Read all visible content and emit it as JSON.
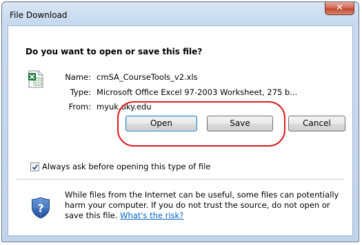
{
  "window": {
    "title": "File Download",
    "close_glyph": "✕"
  },
  "dialog": {
    "question": "Do you want to open or save this file?",
    "file_icon": "excel-file-icon",
    "fields": [
      {
        "label": "Name:",
        "value": "cmSA_CourseTools_v2.xls"
      },
      {
        "label": "Type:",
        "value": "Microsoft Office Excel 97-2003 Worksheet, 275 b..."
      },
      {
        "label": "From:",
        "value": "myuk.uky.edu"
      }
    ],
    "buttons": {
      "open": "Open",
      "save": "Save",
      "cancel": "Cancel"
    },
    "highlight_color": "#e0191e",
    "always_ask": {
      "checked": true,
      "label": "Always ask before opening this type of file"
    },
    "warning": {
      "icon": "security-shield-question-icon",
      "line1": "While files from the Internet can be useful, some files can potentially",
      "line2": "harm your computer. If you do not trust the source, do not open or",
      "line3_prefix": "save this file. ",
      "link": "What's the risk?"
    }
  }
}
